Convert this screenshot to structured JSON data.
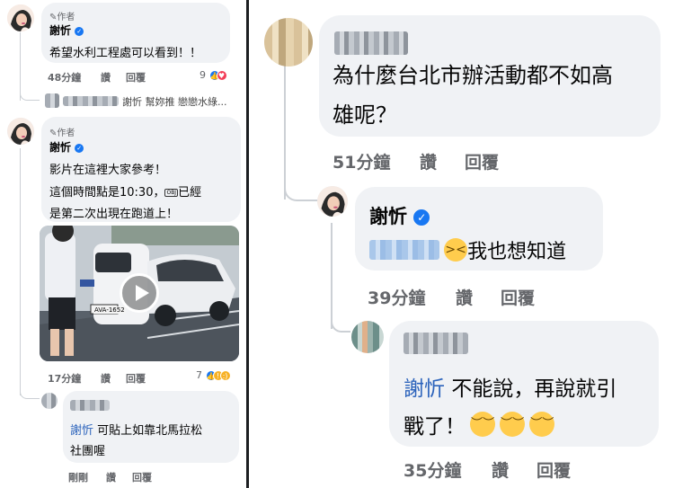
{
  "left": {
    "comment1": {
      "author_tag": "作者",
      "author": "謝忻",
      "text": "希望水利工程處可以看到！！",
      "time": "48分鐘",
      "like": "讚",
      "reply": "回覆",
      "reaction_count": "9",
      "reply_preview": "謝忻 幫妳推 戀戀水綠..."
    },
    "comment2": {
      "author_tag": "作者",
      "author": "謝忻",
      "line1": "影片在這裡大家參考！",
      "line2": "這個時間點是10:30，",
      "obj": "OBJ",
      "line2_tail": "已經",
      "line3": "是第二次出現在跑道上！",
      "plate": "AVA-1652",
      "time": "17分鐘",
      "like": "讚",
      "reply": "回覆",
      "reaction_count": "7"
    },
    "reply": {
      "mention": "謝忻",
      "text1": "可貼上如靠北馬拉松",
      "text2": "社團喔",
      "time": "剛剛",
      "like": "讚",
      "reply": "回覆"
    }
  },
  "right": {
    "comment1": {
      "line1": "為什麼台北市辦活動都不如高",
      "line2": "雄呢？",
      "time": "51分鐘",
      "like": "讚",
      "reply": "回覆"
    },
    "comment2": {
      "author": "謝忻",
      "text": "我也想知道",
      "time": "39分鐘",
      "like": "讚",
      "reply": "回覆"
    },
    "comment3": {
      "mention": "謝忻",
      "text1": "不能說，再說就引",
      "text2": "戰了！",
      "time": "35分鐘",
      "like": "讚",
      "reply": "回覆"
    }
  },
  "icons": {
    "verified": "verified-badge-icon",
    "pencil": "pencil-icon",
    "play": "play-icon",
    "emoji_grin": "grinning-squinting-face",
    "emoji_pensive": "pensive-face"
  },
  "colors": {
    "bubble": "#f0f2f5",
    "meta": "#65676b",
    "mention": "#2d64bc",
    "verified": "#1877f2",
    "divider": "#1c1e21"
  }
}
